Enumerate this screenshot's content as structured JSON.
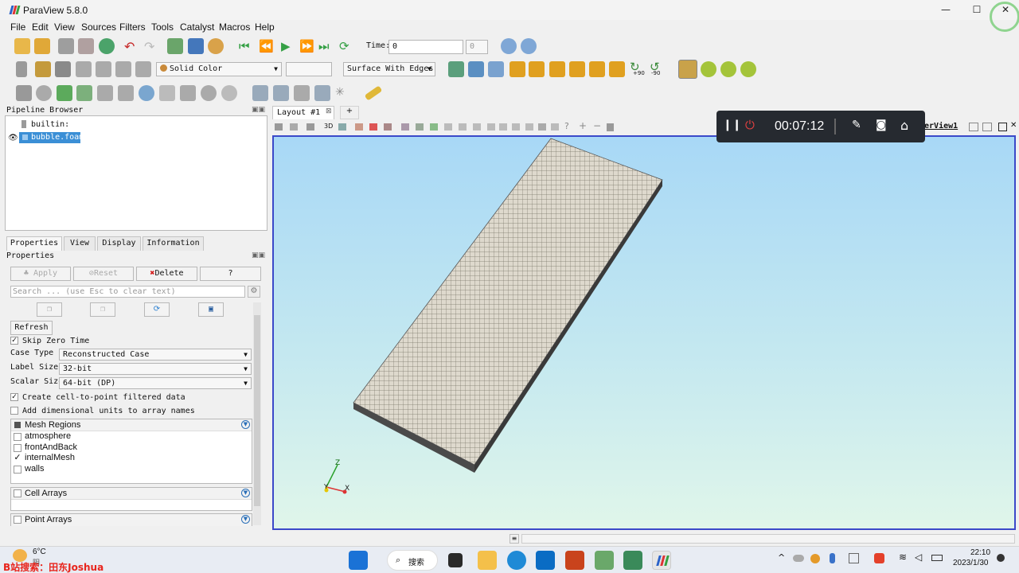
{
  "window": {
    "title": "ParaView 5.8.0",
    "minimize": "—",
    "maximize": "☐",
    "close": "✕"
  },
  "menu": [
    "File",
    "Edit",
    "View",
    "Sources",
    "Filters",
    "Tools",
    "Catalyst",
    "Macros",
    "Help"
  ],
  "toolbar": {
    "time_label": "Time:",
    "time_value": "0",
    "time_index": "0",
    "coloring": "Solid Color",
    "representation": "Surface With Edges",
    "rotate_pos": "+90",
    "rotate_neg": "-90"
  },
  "pipeline": {
    "title": "Pipeline Browser",
    "items": [
      {
        "label": "builtin:"
      },
      {
        "label": "bubble.foam"
      }
    ]
  },
  "tabs": [
    "Properties",
    "View",
    "Display",
    "Information"
  ],
  "properties": {
    "title": "Properties",
    "apply": "Apply",
    "reset": "Reset",
    "delete": "Delete",
    "help": "?",
    "search_placeholder": "Search ... (use Esc to clear text)",
    "refresh": "Refresh",
    "skip_zero_time": "Skip Zero Time",
    "case_type_label": "Case Type",
    "case_type_value": "Reconstructed Case",
    "label_size_label": "Label Size",
    "label_size_value": "32-bit",
    "scalar_size_label": "Scalar Size",
    "scalar_size_value": "64-bit (DP)",
    "cell_to_point": "Create cell-to-point filtered data",
    "dimensional_units": "Add dimensional units to array names",
    "mesh_regions": {
      "header": "Mesh Regions",
      "items": [
        {
          "label": "atmosphere",
          "checked": false
        },
        {
          "label": "frontAndBack",
          "checked": false
        },
        {
          "label": "internalMesh",
          "checked": true
        },
        {
          "label": "walls",
          "checked": false
        }
      ]
    },
    "cell_arrays": "Cell Arrays",
    "point_arrays": "Point Arrays"
  },
  "layout": {
    "tab": "Layout #1",
    "add": "+",
    "view_name": "derView1",
    "mode_3d": "3D"
  },
  "axes": {
    "x": "X",
    "y": "Y",
    "z": "Z"
  },
  "recorder": {
    "time": "00:07:12"
  },
  "taskbar": {
    "weather_temp": "6°C",
    "weather_text": "阴",
    "search": "搜索",
    "clock_time": "22:10",
    "clock_date": "2023/1/30",
    "watermark": "B站搜索：田东Joshua"
  },
  "colors": {
    "viewport_border": "#3b49c9",
    "selection": "#3b8fd6",
    "accent_green": "#4caf50",
    "delete_red": "#d62020"
  }
}
